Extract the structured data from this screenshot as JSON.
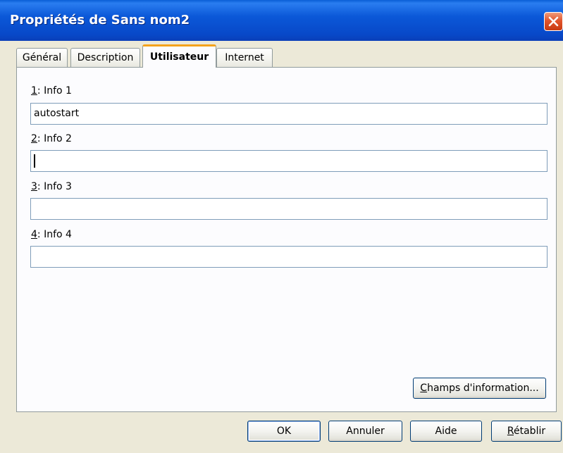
{
  "window": {
    "title": "Propriétés de Sans nom2",
    "close_icon": "close-icon"
  },
  "tabs": [
    {
      "label": "Général",
      "active": false
    },
    {
      "label": "Description",
      "active": false
    },
    {
      "label": "Utilisateur",
      "active": true
    },
    {
      "label": "Internet",
      "active": false
    }
  ],
  "fields": [
    {
      "mnemonic": "1",
      "label_rest": ": Info 1",
      "value": "autostart"
    },
    {
      "mnemonic": "2",
      "label_rest": ": Info 2",
      "value": ""
    },
    {
      "mnemonic": "3",
      "label_rest": ": Info 3",
      "value": ""
    },
    {
      "mnemonic": "4",
      "label_rest": ": Info 4",
      "value": ""
    }
  ],
  "buttons": {
    "champs": {
      "mnemonic": "C",
      "rest": "hamps d'information..."
    },
    "ok": {
      "label": "OK"
    },
    "annuler": {
      "label": "Annuler"
    },
    "aide": {
      "label": "Aide"
    },
    "retablir": {
      "mnemonic": "R",
      "rest": "établir"
    }
  },
  "colors": {
    "titlebar": "#0a58d8",
    "dialog_bg": "#ece9d8",
    "active_tab_accent": "#f4a31c",
    "close_button": "#e2552c"
  }
}
